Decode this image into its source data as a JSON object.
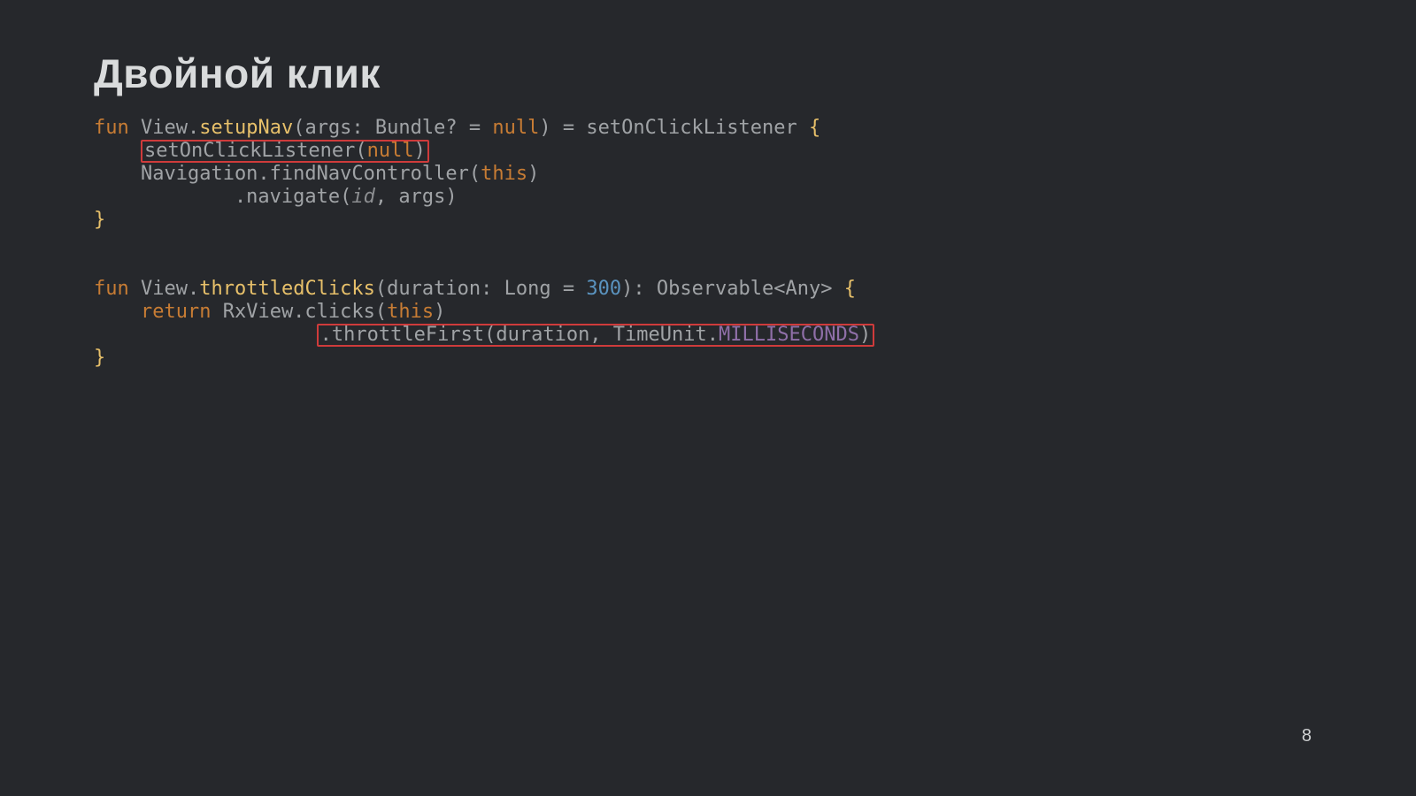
{
  "title": "Двойной клик",
  "page_number": "8",
  "code1": {
    "l1_a": "fun",
    "l1_b": " View.",
    "l1_c": "setupNav",
    "l1_d": "(args: Bundle? = ",
    "l1_e": "null",
    "l1_f": ") = setOnClickListener ",
    "l1_g": "{",
    "l2_indent": "    ",
    "l2_box": "setOnClickListener(",
    "l2_null": "null",
    "l2_box_end": ")",
    "l3": "    Navigation.findNavController(",
    "l3_this": "this",
    "l3_end": ")",
    "l4_a": "            .navigate(",
    "l4_id": "id",
    "l4_b": ", args)",
    "l5": "}"
  },
  "code2": {
    "l1_a": "fun",
    "l1_b": " View.",
    "l1_c": "throttledClicks",
    "l1_d": "(duration: Long = ",
    "l1_e": "300",
    "l1_f": "): Observable<Any> ",
    "l1_g": "{",
    "l2_a": "    ",
    "l2_ret": "return",
    "l2_b": " RxView.clicks(",
    "l2_this": "this",
    "l2_c": ")",
    "l3_indent": "                   ",
    "l3_box_a": ".throttleFirst(duration, TimeUnit.",
    "l3_const": "MILLISECONDS",
    "l3_box_b": ")",
    "l4": "}"
  }
}
